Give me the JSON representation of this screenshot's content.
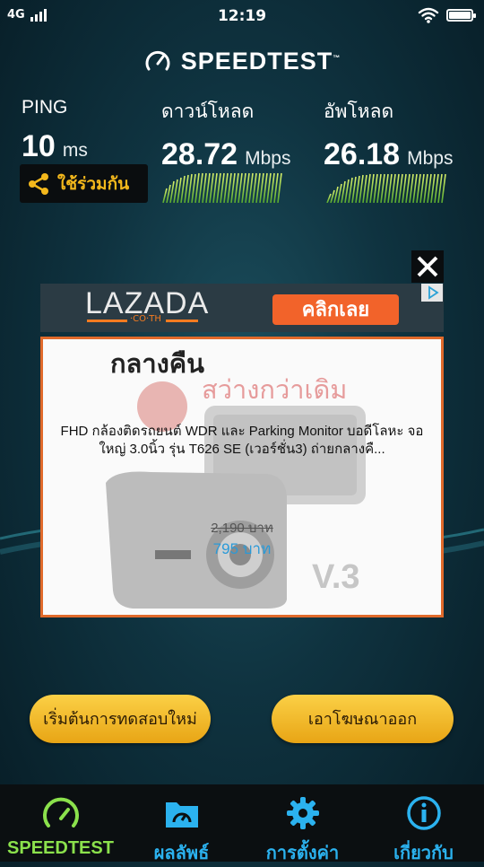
{
  "status_bar": {
    "network": "4G",
    "time": "12:19"
  },
  "app": {
    "logo_text": "SPEEDTEST",
    "logo_tm": "™"
  },
  "metrics": {
    "ping": {
      "label": "PING",
      "value": "10",
      "unit": "ms"
    },
    "download": {
      "label": "ดาวน์โหลด",
      "value": "28.72",
      "unit": "Mbps"
    },
    "upload": {
      "label": "อัพโหลด",
      "value": "26.18",
      "unit": "Mbps"
    }
  },
  "share": {
    "label": "ใช้ร่วมกัน",
    "icon": "share-icon"
  },
  "ad": {
    "brand": "LAZADA",
    "brand_sub": "·CO·TH",
    "cta": "คลิกเลย",
    "banner_text_1": "กลางคืน",
    "banner_text_2": "สว่างกว่าเดิม",
    "banner_badge": "V.3",
    "description": "FHD กล้องติดรถยนต์ WDR และ Parking Monitor บอดีโลหะ จอใหญ่ 3.0นิ้ว รุ่น T626 SE (เวอร์ชั่น3) ถ่ายกลางคื...",
    "old_price": "2,190 บาท",
    "new_price": "795 บาท"
  },
  "buttons": {
    "restart": "เริ่มต้นการทดสอบใหม่",
    "remove_ads": "เอาโฆษณาออก"
  },
  "tabs": [
    {
      "label": "SPEEDTEST",
      "icon": "gauge-icon",
      "active": true
    },
    {
      "label": "ผลลัพธ์",
      "icon": "results-folder-icon",
      "active": false
    },
    {
      "label": "การตั้งค่า",
      "icon": "gear-icon",
      "active": false
    },
    {
      "label": "เกี่ยวกับ",
      "icon": "info-icon",
      "active": false
    }
  ],
  "colors": {
    "accent_yellow": "#f3b81c",
    "active_tab": "#8be14c",
    "tab_blue": "#2bb2ef",
    "cta_orange": "#f2632a"
  }
}
